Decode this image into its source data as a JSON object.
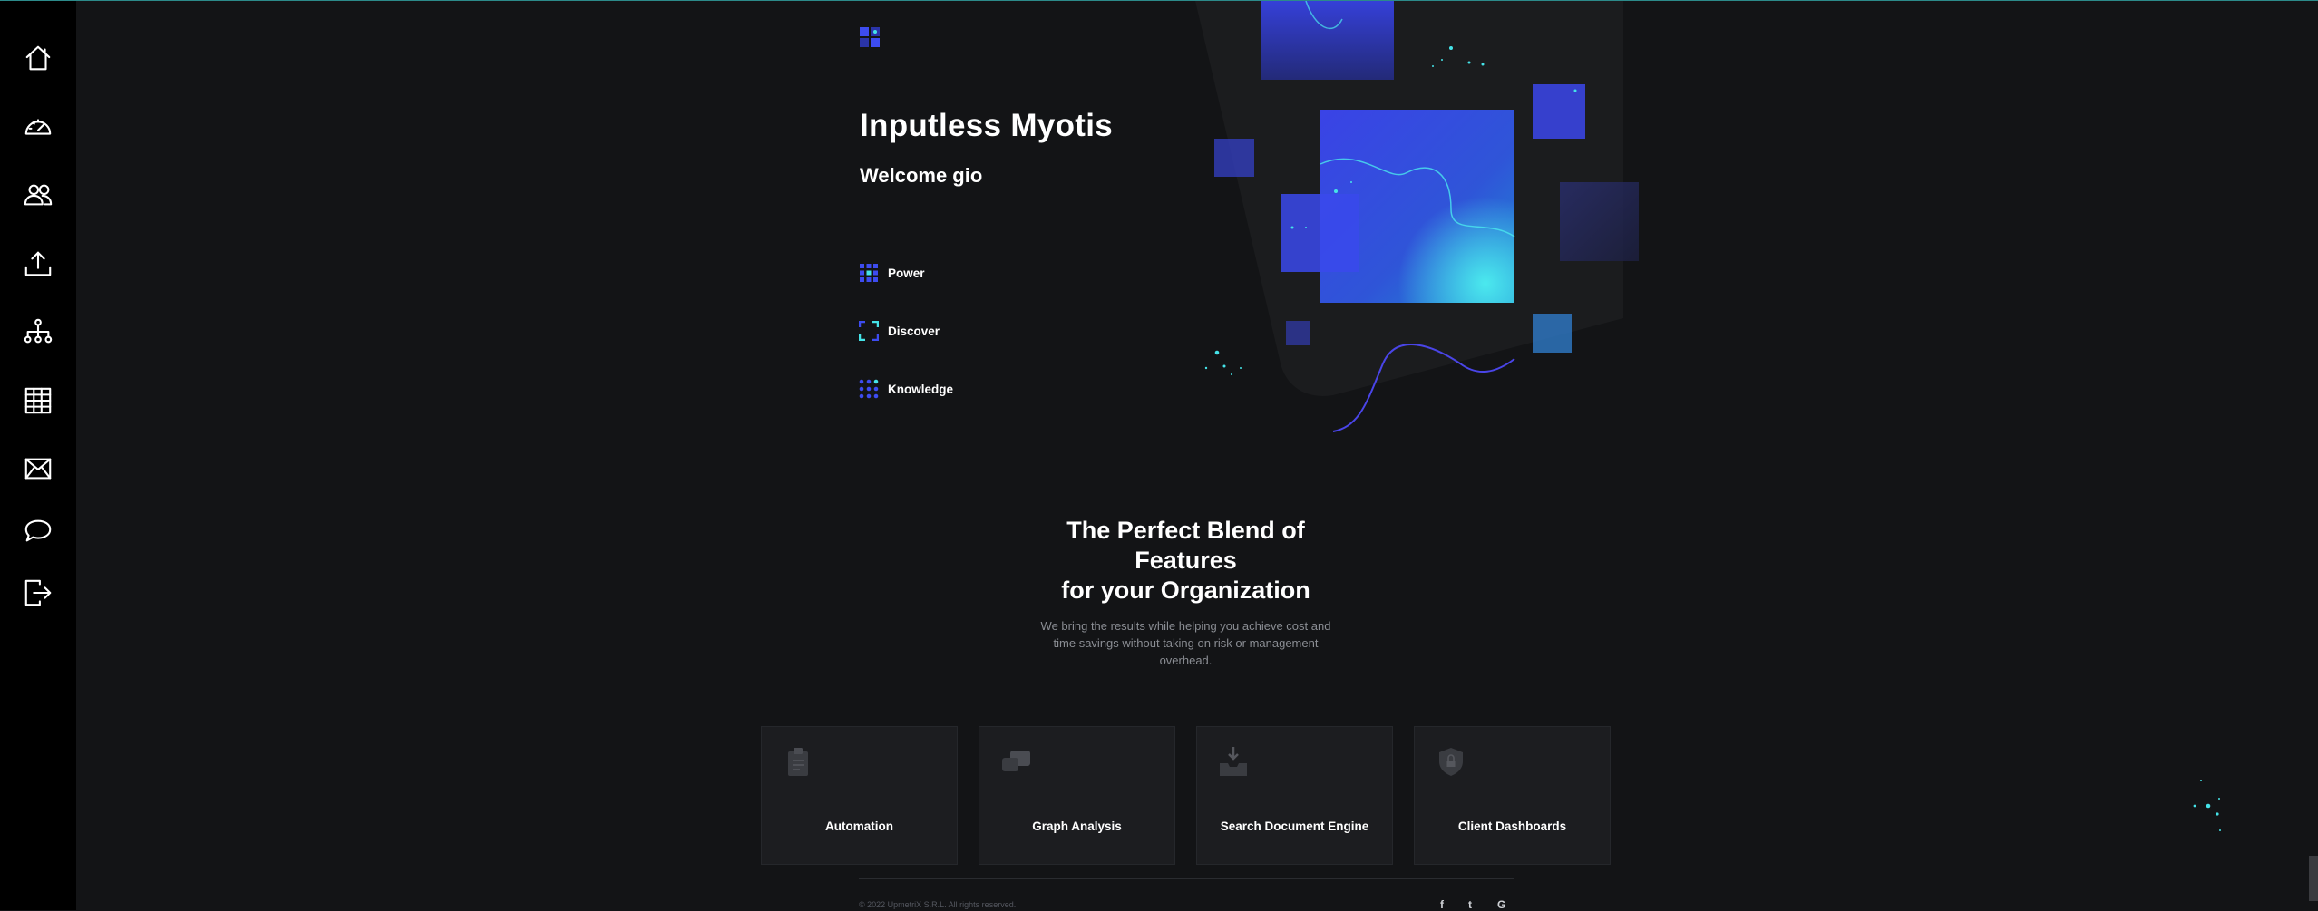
{
  "sidebar": {
    "items": [
      {
        "icon": "home-icon",
        "name": "sidebar-item-home"
      },
      {
        "icon": "gauge-icon",
        "name": "sidebar-item-dashboard"
      },
      {
        "icon": "users-icon",
        "name": "sidebar-item-users"
      },
      {
        "icon": "upload-icon",
        "name": "sidebar-item-upload"
      },
      {
        "icon": "network-icon",
        "name": "sidebar-item-network"
      },
      {
        "icon": "table-icon",
        "name": "sidebar-item-table"
      },
      {
        "icon": "mail-icon",
        "name": "sidebar-item-mail"
      },
      {
        "icon": "chat-icon",
        "name": "sidebar-item-chat"
      },
      {
        "icon": "logout-icon",
        "name": "sidebar-item-logout"
      }
    ]
  },
  "hero": {
    "title": "Inputless Myotis",
    "welcome": "Welcome gio",
    "features": [
      {
        "label": "Power",
        "icon": "grid-dots-icon"
      },
      {
        "label": "Discover",
        "icon": "focus-frame-icon"
      },
      {
        "label": "Knowledge",
        "icon": "dots-matrix-icon"
      }
    ]
  },
  "blend": {
    "title_line1": "The Perfect Blend of",
    "title_line2": "Features",
    "title_line3": "for your Organization",
    "description": "We bring the results while helping you achieve cost and time savings without taking on risk or management overhead."
  },
  "cards": [
    {
      "title": "Automation",
      "icon": "clipboard-icon"
    },
    {
      "title": "Graph Analysis",
      "icon": "chat-bubbles-icon"
    },
    {
      "title": "Search Document Engine",
      "icon": "inbox-download-icon"
    },
    {
      "title": "Client Dashboards",
      "icon": "shield-lock-icon"
    }
  ],
  "footer": {
    "copyright": "© 2022 UpmetriX S.R.L. All rights reserved.",
    "social": [
      "f",
      "t",
      "G"
    ]
  },
  "colors": {
    "background": "#131416",
    "sidebar": "#000000",
    "accent_blue": "#3d4cf0",
    "accent_cyan": "#45e3e8",
    "card": "#1c1d20"
  }
}
